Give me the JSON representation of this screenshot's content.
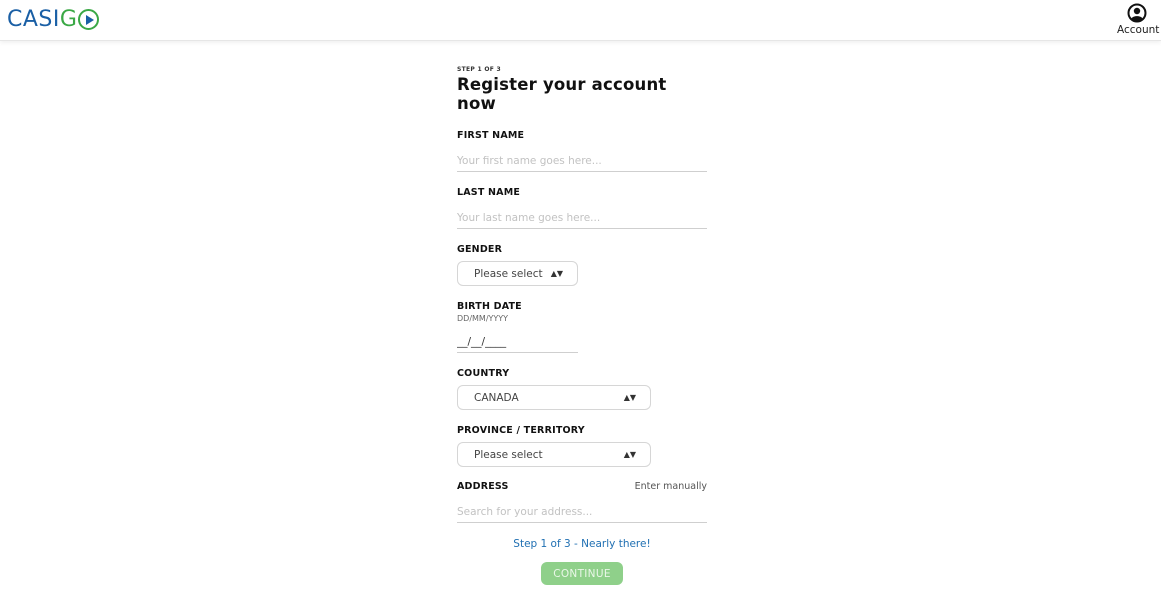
{
  "header": {
    "logo_part1": "CASI",
    "logo_part2": "G",
    "account_label": "Account",
    "account_icon": "user-circle-icon"
  },
  "form": {
    "step_small": "STEP 1 OF 3",
    "title": "Register your account now",
    "first_name": {
      "label": "FIRST NAME",
      "placeholder": "Your first name goes here...",
      "value": ""
    },
    "last_name": {
      "label": "LAST NAME",
      "placeholder": "Your last name goes here...",
      "value": ""
    },
    "gender": {
      "label": "GENDER",
      "selected": "Please select"
    },
    "birth_date": {
      "label": "BIRTH DATE",
      "hint": "DD/MM/YYYY",
      "value": "__/__/____"
    },
    "country": {
      "label": "COUNTRY",
      "selected": "CANADA"
    },
    "province": {
      "label": "PROVINCE / TERRITORY",
      "selected": "Please select"
    },
    "address": {
      "label": "ADDRESS",
      "enter_manually": "Enter manually",
      "placeholder": "Search for your address..."
    }
  },
  "footer": {
    "progress_text": "Step 1 of 3 - Nearly there!",
    "continue_label": "CONTINUE"
  },
  "colors": {
    "brand_blue": "#1a5fa5",
    "brand_green": "#3aa845",
    "continue_bg": "#8fd08a",
    "progress_text": "#1f6fb2"
  }
}
